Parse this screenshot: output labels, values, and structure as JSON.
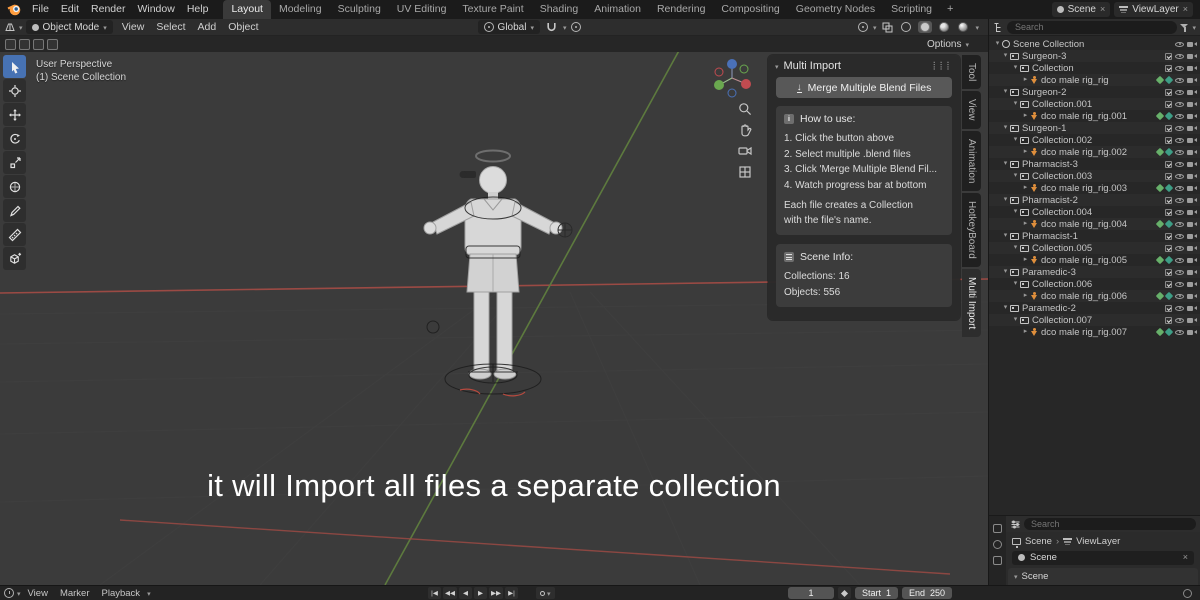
{
  "topbar": {
    "menus": [
      "File",
      "Edit",
      "Render",
      "Window",
      "Help"
    ],
    "workspaces": [
      {
        "label": "Layout",
        "active": true
      },
      {
        "label": "Modeling"
      },
      {
        "label": "Sculpting"
      },
      {
        "label": "UV Editing"
      },
      {
        "label": "Texture Paint"
      },
      {
        "label": "Shading"
      },
      {
        "label": "Animation"
      },
      {
        "label": "Rendering"
      },
      {
        "label": "Compositing"
      },
      {
        "label": "Geometry Nodes"
      },
      {
        "label": "Scripting"
      }
    ],
    "add_workspace_label": "+",
    "scene": {
      "label": "Scene"
    },
    "viewlayer": {
      "label": "ViewLayer"
    }
  },
  "viewport_header": {
    "mode": "Object Mode",
    "menus": [
      "View",
      "Select",
      "Add",
      "Object"
    ],
    "orientation": "Global",
    "options_label": "Options"
  },
  "viewport": {
    "overlay": [
      "User Perspective",
      "(1) Scene Collection"
    ],
    "caption": "it will Import all files a separate collection"
  },
  "multi_import": {
    "title": "Multi Import",
    "merge_button": "Merge Multiple Blend Files",
    "how_to": {
      "title": "How to use:",
      "steps": [
        "1. Click the button above",
        "2. Select multiple .blend files",
        "3. Click 'Merge Multiple Blend Fil...",
        "4. Watch progress bar at bottom"
      ],
      "note_lines": [
        "Each file creates a Collection",
        "with the file's name."
      ]
    },
    "scene_info": {
      "title": "Scene Info:",
      "lines": [
        "Collections: 16",
        "Objects: 556"
      ]
    }
  },
  "side_tabs": [
    {
      "label": "Tool"
    },
    {
      "label": "View"
    },
    {
      "label": "Animation"
    },
    {
      "label": "HotkeyBoard"
    },
    {
      "label": "Multi Import",
      "active": true
    }
  ],
  "outliner": {
    "search_placeholder": "Search",
    "root_label": "Scene Collection",
    "groups": [
      {
        "name": "Surgeon-3",
        "collection": "Collection",
        "rig": "dco male rig_rig"
      },
      {
        "name": "Surgeon-2",
        "collection": "Collection.001",
        "rig": "dco male rig_rig.001"
      },
      {
        "name": "Surgeon-1",
        "collection": "Collection.002",
        "rig": "dco male rig_rig.002"
      },
      {
        "name": "Pharmacist-3",
        "collection": "Collection.003",
        "rig": "dco male rig_rig.003"
      },
      {
        "name": "Pharmacist-2",
        "collection": "Collection.004",
        "rig": "dco male rig_rig.004"
      },
      {
        "name": "Pharmacist-1",
        "collection": "Collection.005",
        "rig": "dco male rig_rig.005"
      },
      {
        "name": "Paramedic-3",
        "collection": "Collection.006",
        "rig": "dco male rig_rig.006"
      },
      {
        "name": "Paramedic-2",
        "collection": "Collection.007",
        "rig": "dco male rig_rig.007"
      }
    ]
  },
  "properties": {
    "search_placeholder": "Search",
    "breadcrumb": {
      "scene": "Scene",
      "viewlayer": "ViewLayer"
    },
    "scene_field": "Scene",
    "section": "Scene"
  },
  "timeline": {
    "menus": [
      "View",
      "Marker",
      "Playback"
    ],
    "transport": [
      "|◀",
      "◀◀",
      "◀",
      "▶",
      "▶▶",
      "▶|"
    ],
    "current_frame": "1",
    "start_label": "Start",
    "start_value": "1",
    "end_label": "End",
    "end_value": "250"
  },
  "colors": {
    "accent": "#4772b3",
    "axis_x": "#9b4a44",
    "axis_y": "#5d7a3e",
    "armature_icon": "#e08f3c"
  }
}
